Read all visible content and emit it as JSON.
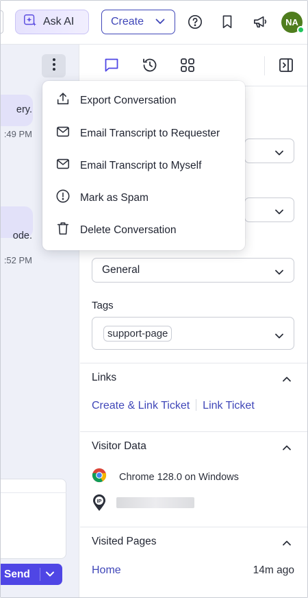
{
  "header": {
    "ask_ai_label": "Ask AI",
    "create_label": "Create",
    "avatar_initials": "NA",
    "avatar_color": "#4f7d1e",
    "status_color": "#22c55e",
    "icons": [
      "sparkle-icon",
      "help-icon",
      "bookmark-icon",
      "megaphone-icon",
      "chevron-down-icon"
    ]
  },
  "conversation": {
    "messages": [
      {
        "text": "ery.",
        "time": ":49 PM"
      },
      {
        "text": "ode.",
        "time": ":52 PM"
      }
    ],
    "send_label": "Send"
  },
  "menu": {
    "items": [
      {
        "label": "Export Conversation",
        "icon": "export-icon"
      },
      {
        "label": "Email Transcript to Requester",
        "icon": "mail-icon"
      },
      {
        "label": "Email Transcript to Myself",
        "icon": "mail-icon"
      },
      {
        "label": "Mark as Spam",
        "icon": "alert-circle-icon"
      },
      {
        "label": "Delete Conversation",
        "icon": "trash-icon"
      }
    ]
  },
  "sidebar": {
    "tab_icons": [
      "chat-icon",
      "history-icon",
      "apps-grid-icon",
      "collapse-panel-icon"
    ],
    "fields": {
      "category_value": "General",
      "tags_label": "Tags",
      "tag_chip": "support-page"
    },
    "links": {
      "title": "Links",
      "create_link": "Create & Link Ticket",
      "link_ticket": "Link Ticket"
    },
    "visitor_data": {
      "title": "Visitor Data",
      "browser": "Chrome 128.0 on Windows"
    },
    "visited_pages": {
      "title": "Visited Pages",
      "page": "Home",
      "time_ago": "14m ago"
    }
  },
  "colors": {
    "accent": "#3f46b8",
    "send_button": "#4f46e5",
    "bubble": "#e2e1f9",
    "pane_bg": "#eef0f8"
  }
}
